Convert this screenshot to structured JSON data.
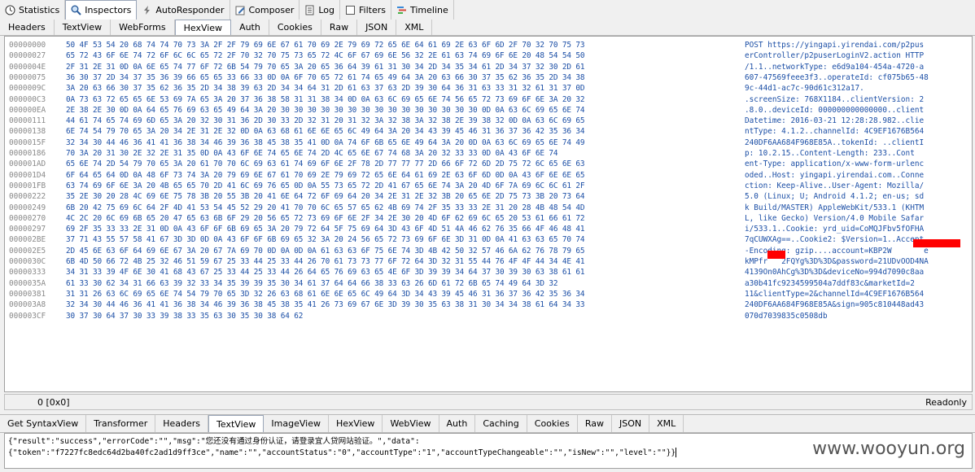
{
  "top_tabs": [
    {
      "label": "Statistics",
      "icon": "clock-icon",
      "active": false
    },
    {
      "label": "Inspectors",
      "icon": "magnifier-icon",
      "active": true
    },
    {
      "label": "AutoResponder",
      "icon": "lightning-icon",
      "active": false
    },
    {
      "label": "Composer",
      "icon": "pencil-icon",
      "active": false
    },
    {
      "label": "Log",
      "icon": "log-icon",
      "active": false
    },
    {
      "label": "Filters",
      "icon": "checkbox-icon",
      "active": false
    },
    {
      "label": "Timeline",
      "icon": "timeline-icon",
      "active": false
    }
  ],
  "request_tabs": [
    "Headers",
    "TextView",
    "WebForms",
    "HexView",
    "Auth",
    "Cookies",
    "Raw",
    "JSON",
    "XML"
  ],
  "request_active": "HexView",
  "hex_rows": [
    {
      "offset": "00000000",
      "hex": "50 4F 53 54 20 68 74 74 70 73 3A 2F 2F 79 69 6E 67 61 70 69 2E 79 69 72 65 6E 64 61 69 2E 63 6F 6D 2F 70 32 70 75 73",
      "ascii": "POST https://yingapi.yirendai.com/p2pus"
    },
    {
      "offset": "00000027",
      "hex": "65 72 43 6F 6E 74 72 6F 6C 6C 65 72 2F 70 32 70 75 73 65 72 4C 6F 67 69 6E 56 32 2E 61 63 74 69 6F 6E 20 48 54 54 50",
      "ascii": "erController/p2puserLoginV2.action HTTP"
    },
    {
      "offset": "0000004E",
      "hex": "2F 31 2E 31 0D 0A 6E 65 74 77 6F 72 6B 54 79 70 65 3A 20 65 36 64 39 61 31 30 34 2D 34 35 34 61 2D 34 37 32 30 2D 61",
      "ascii": "/1.1..networkType: e6d9a104-454a-4720-a"
    },
    {
      "offset": "00000075",
      "hex": "36 30 37 2D 34 37 35 36 39 66 65 65 33 66 33 0D 0A 6F 70 65 72 61 74 65 49 64 3A 20 63 66 30 37 35 62 36 35 2D 34 38",
      "ascii": "607-47569feee3f3..operateId: cf075b65-48"
    },
    {
      "offset": "0000009C",
      "hex": "3A 20 63 66 30 37 35 62 36 35 2D 34 38 39 63 2D 34 34 64 31 2D 61 63 37 63 2D 39 30 64 36 31 63 33 31 32 61 31 37 0D",
      "ascii": "9c-44d1-ac7c-90d61c312a17."
    },
    {
      "offset": "000000C3",
      "hex": "0A 73 63 72 65 65 6E 53 69 7A 65 3A 20 37 36 38 58 31 31 38 34 0D 0A 63 6C 69 65 6E 74 56 65 72 73 69 6F 6E 3A 20 32",
      "ascii": ".screenSize: 768X1184..clientVersion: 2"
    },
    {
      "offset": "000000EA",
      "hex": "2E 38 2E 30 0D 0A 64 65 76 69 63 65 49 64 3A 20 30 30 30 30 30 30 30 30 30 30 30 30 30 30 30 0D 0A 63 6C 69 65 6E 74",
      "ascii": ".8.0..deviceId: 000000000000000..client"
    },
    {
      "offset": "00000111",
      "hex": "44 61 74 65 74 69 6D 65 3A 20 32 30 31 36 2D 30 33 2D 32 31 20 31 32 3A 32 38 3A 32 38 2E 39 38 32 0D 0A 63 6C 69 65",
      "ascii": "Datetime: 2016-03-21 12:28:28.982..clie"
    },
    {
      "offset": "00000138",
      "hex": "6E 74 54 79 70 65 3A 20 34 2E 31 2E 32 0D 0A 63 68 61 6E 6E 65 6C 49 64 3A 20 34 43 39 45 46 31 36 37 36 42 35 36 34",
      "ascii": "ntType: 4.1.2..channelId: 4C9EF1676B564"
    },
    {
      "offset": "0000015F",
      "hex": "32 34 30 44 46 36 41 41 36 38 34 46 39 36 38 45 38 35 41 0D 0A 74 6F 6B 65 6E 49 64 3A 20 0D 0A 63 6C 69 65 6E 74 49",
      "ascii": "240DF6AA684F968E85A..tokenId: ..clientI"
    },
    {
      "offset": "00000186",
      "hex": "70 3A 20 31 30 2E 32 2E 31 35 0D 0A 43 6F 6E 74 65 6E 74 2D 4C 65 6E 67 74 68 3A 20 32 33 33 0D 0A 43 6F 6E 74",
      "ascii": "p: 10.2.15..Content-Length: 233..Cont"
    },
    {
      "offset": "000001AD",
      "hex": "65 6E 74 2D 54 79 70 65 3A 20 61 70 70 6C 69 63 61 74 69 6F 6E 2F 78 2D 77 77 77 2D 66 6F 72 6D 2D 75 72 6C 65 6E 63",
      "ascii": "ent-Type: application/x-www-form-urlenc"
    },
    {
      "offset": "000001D4",
      "hex": "6F 64 65 64 0D 0A 48 6F 73 74 3A 20 79 69 6E 67 61 70 69 2E 79 69 72 65 6E 64 61 69 2E 63 6F 6D 0D 0A 43 6F 6E 6E 65",
      "ascii": "oded..Host: yingapi.yirendai.com..Conne"
    },
    {
      "offset": "000001FB",
      "hex": "63 74 69 6F 6E 3A 20 4B 65 65 70 2D 41 6C 69 76 65 0D 0A 55 73 65 72 2D 41 67 65 6E 74 3A 20 4D 6F 7A 69 6C 6C 61 2F",
      "ascii": "ction: Keep-Alive..User-Agent: Mozilla/"
    },
    {
      "offset": "00000222",
      "hex": "35 2E 30 20 28 4C 69 6E 75 78 3B 20 55 3B 20 41 6E 64 72 6F 69 64 20 34 2E 31 2E 32 3B 20 65 6E 2D 75 73 3B 20 73 64",
      "ascii": "5.0 (Linux; U; Android 4.1.2; en-us; sd"
    },
    {
      "offset": "00000249",
      "hex": "6B 20 42 75 69 6C 64 2F 4D 41 53 54 45 52 29 20 41 70 70 6C 65 57 65 62 4B 69 74 2F 35 33 33 2E 31 20 28 4B 48 54 4D",
      "ascii": "k Build/MASTER) AppleWebKit/533.1 (KHTM"
    },
    {
      "offset": "00000270",
      "hex": "4C 2C 20 6C 69 6B 65 20 47 65 63 6B 6F 29 20 56 65 72 73 69 6F 6E 2F 34 2E 30 20 4D 6F 62 69 6C 65 20 53 61 66 61 72",
      "ascii": "L, like Gecko) Version/4.0 Mobile Safar"
    },
    {
      "offset": "00000297",
      "hex": "69 2F 35 33 33 2E 31 0D 0A 43 6F 6F 6B 69 65 3A 20 79 72 64 5F 75 69 64 3D 43 6F 4D 51 4A 46 62 76 35 66 4F 46 48 41",
      "ascii": "i/533.1..Cookie: yrd_uid=CoMQJFbv5fOFHA"
    },
    {
      "offset": "000002BE",
      "hex": "37 71 43 55 57 58 41 67 3D 3D 0D 0A 43 6F 6F 6B 69 65 32 3A 20 24 56 65 72 73 69 6F 6E 3D 31 0D 0A 41 63 63 65 70 74",
      "ascii": "7qCUWXAg==..Cookie2: $Version=1..Accept"
    },
    {
      "offset": "000002E5",
      "hex": "2D 45 6E 63 6F 64 69 6E 67 3A 20 67 7A 69 70 0D 0A 0D 0A 61 63 63 6F 75 6E 74 3D 4B 42 50 32 57 46 6A 62 76 78 79 65",
      "ascii": "-Encoding: gzip....account=KBP2W       e"
    },
    {
      "offset": "0000030C",
      "hex": "6B 4D 50 66 72 4B 25 32 46 51 59 67 25 33 44 25 33 44 26 70 61 73 73 77 6F 72 64 3D 32 31 55 44 76 4F 4F 44 34 4E 41",
      "ascii": "kMPfr   2FQYg%3D%3D&password=21UDvOOD4NA"
    },
    {
      "offset": "00000333",
      "hex": "34 31 33 39 4F 6E 30 41 68 43 67 25 33 44 25 33 44 26 64 65 76 69 63 65 4E 6F 3D 39 39 34 64 37 30 39 30 63 38 61 61",
      "ascii": "4139On0AhCg%3D%3D&deviceNo=994d7090c8aa"
    },
    {
      "offset": "0000035A",
      "hex": "61 33 30 62 34 31 66 63 39 32 33 34 35 39 39 35 30 34 61 37 64 64 66 38 33 63 26 6D 61 72 6B 65 74 49 64 3D 32",
      "ascii": "a30b41fc923459950​4a7ddf83c&marketId=2"
    },
    {
      "offset": "00000381",
      "hex": "31 31 26 63 6C 69 65 6E 74 54 79 70 65 3D 32 26 63 68 61 6E 6E 65 6C 49 64 3D 34 43 39 45 46 31 36 37 36 42 35 36 34",
      "ascii": "11&clientType=2&channelId=4C9EF1676B564"
    },
    {
      "offset": "000003A8",
      "hex": "32 34 30 44 46 36 41 41 36 38 34 46 39 36 38 45 38 35 41 26 73 69 67 6E 3D 39 30 35 63 38 31 30 34 34 38 61 64 34 33",
      "ascii": "240DF6AA684F968E85A&sign=905c810448ad43"
    },
    {
      "offset": "000003CF",
      "hex": "30 37 30 64 37 30 33 39 38 33 35 63 30 35 30 38 64 62",
      "ascii": "070d7039835c0508db"
    }
  ],
  "status": {
    "position": "0 [0x0]",
    "state": "Readonly"
  },
  "response_tabs": [
    "Get SyntaxView",
    "Transformer",
    "Headers",
    "TextView",
    "ImageView",
    "HexView",
    "WebView",
    "Auth",
    "Caching",
    "Cookies",
    "Raw",
    "JSON",
    "XML"
  ],
  "response_active": "TextView",
  "response_text": {
    "line1": "{\"result\":\"success\",\"errorCode\":\"\",\"msg\":\"您还没有通过身份认证，请登录宜人贷网站验证。\",\"data\":",
    "line2": "{\"token\":\"f7227fc8edc64d2ba40fc2ad1d9ff3ce\",\"name\":\"\",\"accountStatus\":\"0\",\"accountType\":\"1\",\"accountTypeChangeable\":\"\",\"isNew\":\"\",\"level\":\"\"}}"
  },
  "watermark": "www.wooyun.org",
  "colors": {
    "hex": "#1c4fa6",
    "offset": "#8a8a8a",
    "redaction": "#ff0000"
  }
}
